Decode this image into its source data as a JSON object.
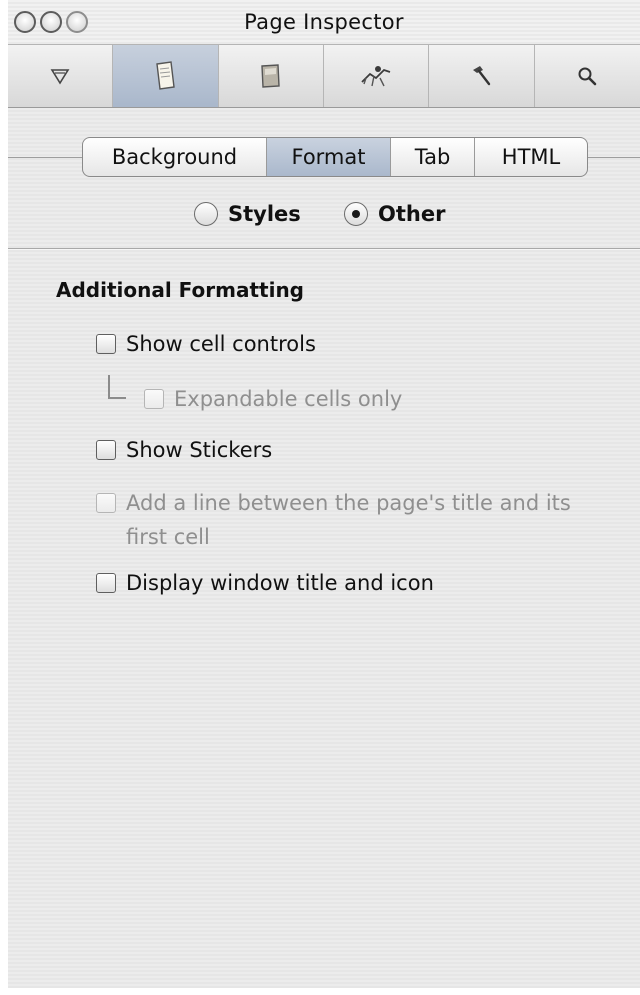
{
  "window": {
    "title": "Page Inspector"
  },
  "toolbar": {
    "items": [
      {
        "icon": "filter-funnel-icon"
      },
      {
        "icon": "page-icon",
        "active": true
      },
      {
        "icon": "cell-icon"
      },
      {
        "icon": "actions-icon"
      },
      {
        "icon": "hammer-icon"
      },
      {
        "icon": "search-icon"
      }
    ]
  },
  "tabs": {
    "items": [
      {
        "label": "Background"
      },
      {
        "label": "Format",
        "active": true
      },
      {
        "label": "Tab"
      },
      {
        "label": "HTML"
      }
    ]
  },
  "mode": {
    "options": [
      {
        "label": "Styles",
        "checked": false
      },
      {
        "label": "Other",
        "checked": true
      }
    ]
  },
  "formatting": {
    "title": "Additional Formatting",
    "options": [
      {
        "label": "Show cell controls",
        "checked": false,
        "enabled": true
      },
      {
        "label": "Expandable cells only",
        "checked": false,
        "enabled": false
      },
      {
        "label": "Show Stickers",
        "checked": false,
        "enabled": true
      },
      {
        "label": "Add a line between the page's title and its first cell",
        "checked": false,
        "enabled": false
      },
      {
        "label": "Display window title and icon",
        "checked": false,
        "enabled": true
      }
    ]
  },
  "colors": {
    "active_segment": "#aab8cc",
    "disabled_text": "#8f8f8f"
  }
}
